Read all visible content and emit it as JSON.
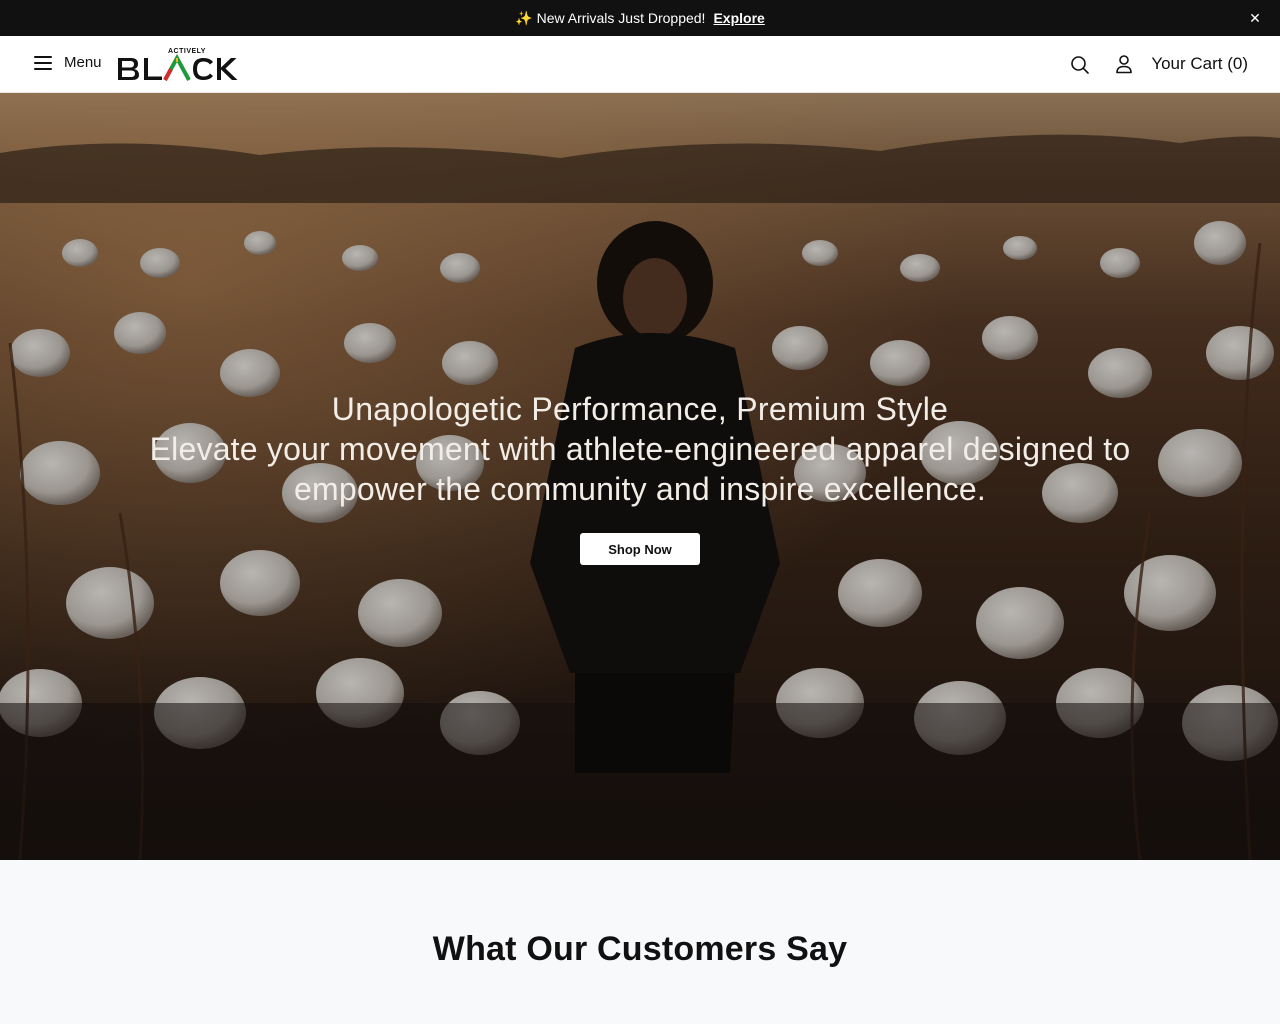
{
  "announcement": {
    "icon": "sparkles-icon",
    "message": "New Arrivals Just Dropped!",
    "link_label": "Explore",
    "close_label": "✕"
  },
  "header": {
    "menu_label": "Menu",
    "logo_top": "ACTIVELY",
    "logo_main": "BLACK",
    "cart_label": "Your Cart (0)"
  },
  "hero": {
    "title": "Unapologetic Performance, Premium Style",
    "subtitle": "Elevate your movement with athlete-engineered apparel designed to empower the community and inspire excellence.",
    "cta_label": "Shop Now"
  },
  "testimonials": {
    "heading": "What Our Customers Say"
  },
  "colors": {
    "topbar": "#111111",
    "logo_red": "#d62b2b",
    "logo_green": "#1f9a3b",
    "logo_gold": "#f0b429"
  }
}
